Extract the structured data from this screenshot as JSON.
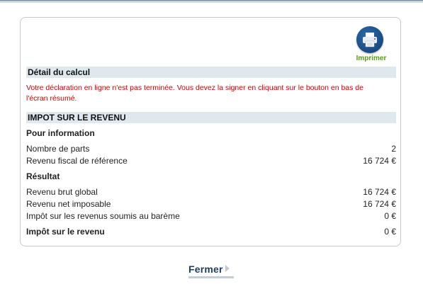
{
  "print": {
    "label": "Imprimer",
    "icon": "printer-icon"
  },
  "detail": {
    "title": "Détail du calcul",
    "warning": "Votre déclaration en ligne n'est pas terminée. Vous devez la signer en cliquant sur le bouton en bas de l'écran résumé."
  },
  "impot": {
    "title": "IMPOT SUR LE REVENU",
    "info_title": "Pour information",
    "info_rows": [
      {
        "label": "Nombre de parts",
        "value": "2"
      },
      {
        "label": "Revenu fiscal de référence",
        "value": "16 724 €"
      }
    ],
    "result_title": "Résultat",
    "result_rows": [
      {
        "label": "Revenu brut global",
        "value": "16 724 €"
      },
      {
        "label": "Revenu net imposable",
        "value": "16 724 €"
      },
      {
        "label": "Impôt sur les revenus soumis au barème",
        "value": "0 €"
      }
    ],
    "total": {
      "label": "Impôt sur le revenu",
      "value": "0 €"
    }
  },
  "close": {
    "label": "Fermer"
  },
  "colors": {
    "section_bg": "#dfe8ef",
    "warning": "#d00000",
    "print_label": "#5a9a1c",
    "print_circle": "#1c4f86",
    "close_label": "#1f3f62"
  }
}
